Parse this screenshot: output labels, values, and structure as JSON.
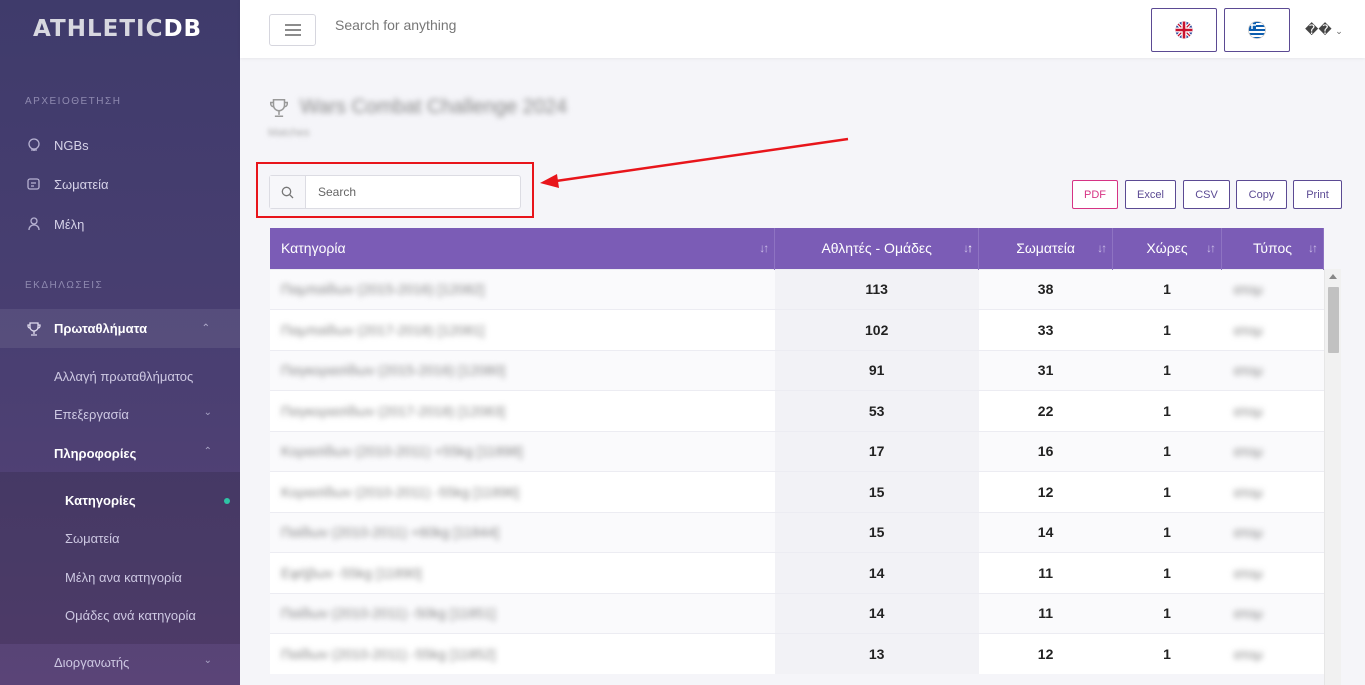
{
  "app": {
    "logo_main": "ATHLETIC",
    "logo_accent": "DB"
  },
  "sidebar": {
    "section_archive": "ΑΡΧΕΙΟΘΕΤΗΣΗ",
    "section_events": "ΕΚΔΗΛΩΣΕΙΣ",
    "items": [
      {
        "label": "NGBs",
        "icon": "globe-icon"
      },
      {
        "label": "Σωματεία",
        "icon": "club-icon"
      },
      {
        "label": "Μέλη",
        "icon": "person-icon"
      }
    ],
    "championships": {
      "label": "Πρωταθλήματα",
      "icon": "trophy-icon"
    },
    "change_championship": "Αλλαγή πρωταθλήματος",
    "editing": "Επεξεργασία",
    "info": "Πληροφορίες",
    "info_items": [
      "Κατηγορίες",
      "Σωματεία",
      "Μέλη ανα κατηγορία",
      "Ομάδες ανά κατηγορία"
    ],
    "organizer": "Διοργανωτής"
  },
  "header": {
    "search_placeholder": "Search for anything",
    "user_label": "��",
    "flags": [
      "uk-flag-icon",
      "greece-flag-icon"
    ]
  },
  "page": {
    "title": "Wars Combat Challenge 2024",
    "subtitle": "Matches"
  },
  "table_search": {
    "placeholder": "Search"
  },
  "export_buttons": [
    "PDF",
    "Excel",
    "CSV",
    "Copy",
    "Print"
  ],
  "table": {
    "columns": [
      "Κατηγορία",
      "Αθλητές - Ομάδες",
      "Σωματεία",
      "Χώρες",
      "Τύπος"
    ],
    "rows": [
      {
        "category": "Παμπαίδων (2015-2016) [12082]",
        "athletes": "113",
        "clubs": "38",
        "countries": "1",
        "type": "ατομ"
      },
      {
        "category": "Παμπαίδων (2017-2018) [12081]",
        "athletes": "102",
        "clubs": "33",
        "countries": "1",
        "type": "ατομ"
      },
      {
        "category": "Παγκορασίδων (2015-2016) [12080]",
        "athletes": "91",
        "clubs": "31",
        "countries": "1",
        "type": "ατομ"
      },
      {
        "category": "Παγκορασίδων (2017-2018) [12083]",
        "athletes": "53",
        "clubs": "22",
        "countries": "1",
        "type": "ατομ"
      },
      {
        "category": "Κορασίδων (2010-2011) +55kg [11898]",
        "athletes": "17",
        "clubs": "16",
        "countries": "1",
        "type": "ατομ"
      },
      {
        "category": "Κορασίδων (2010-2011) -55kg [11896]",
        "athletes": "15",
        "clubs": "12",
        "countries": "1",
        "type": "ατομ"
      },
      {
        "category": "Παίδων (2010-2011) +60kg [11844]",
        "athletes": "15",
        "clubs": "14",
        "countries": "1",
        "type": "ατομ"
      },
      {
        "category": "Εφήβων -55kg [11890]",
        "athletes": "14",
        "clubs": "11",
        "countries": "1",
        "type": "ατομ"
      },
      {
        "category": "Παίδων (2010-2011) -50kg [11851]",
        "athletes": "14",
        "clubs": "11",
        "countries": "1",
        "type": "ατομ"
      },
      {
        "category": "Παίδων (2010-2011) -55kg [11852]",
        "athletes": "13",
        "clubs": "12",
        "countries": "1",
        "type": "ατομ"
      }
    ]
  }
}
